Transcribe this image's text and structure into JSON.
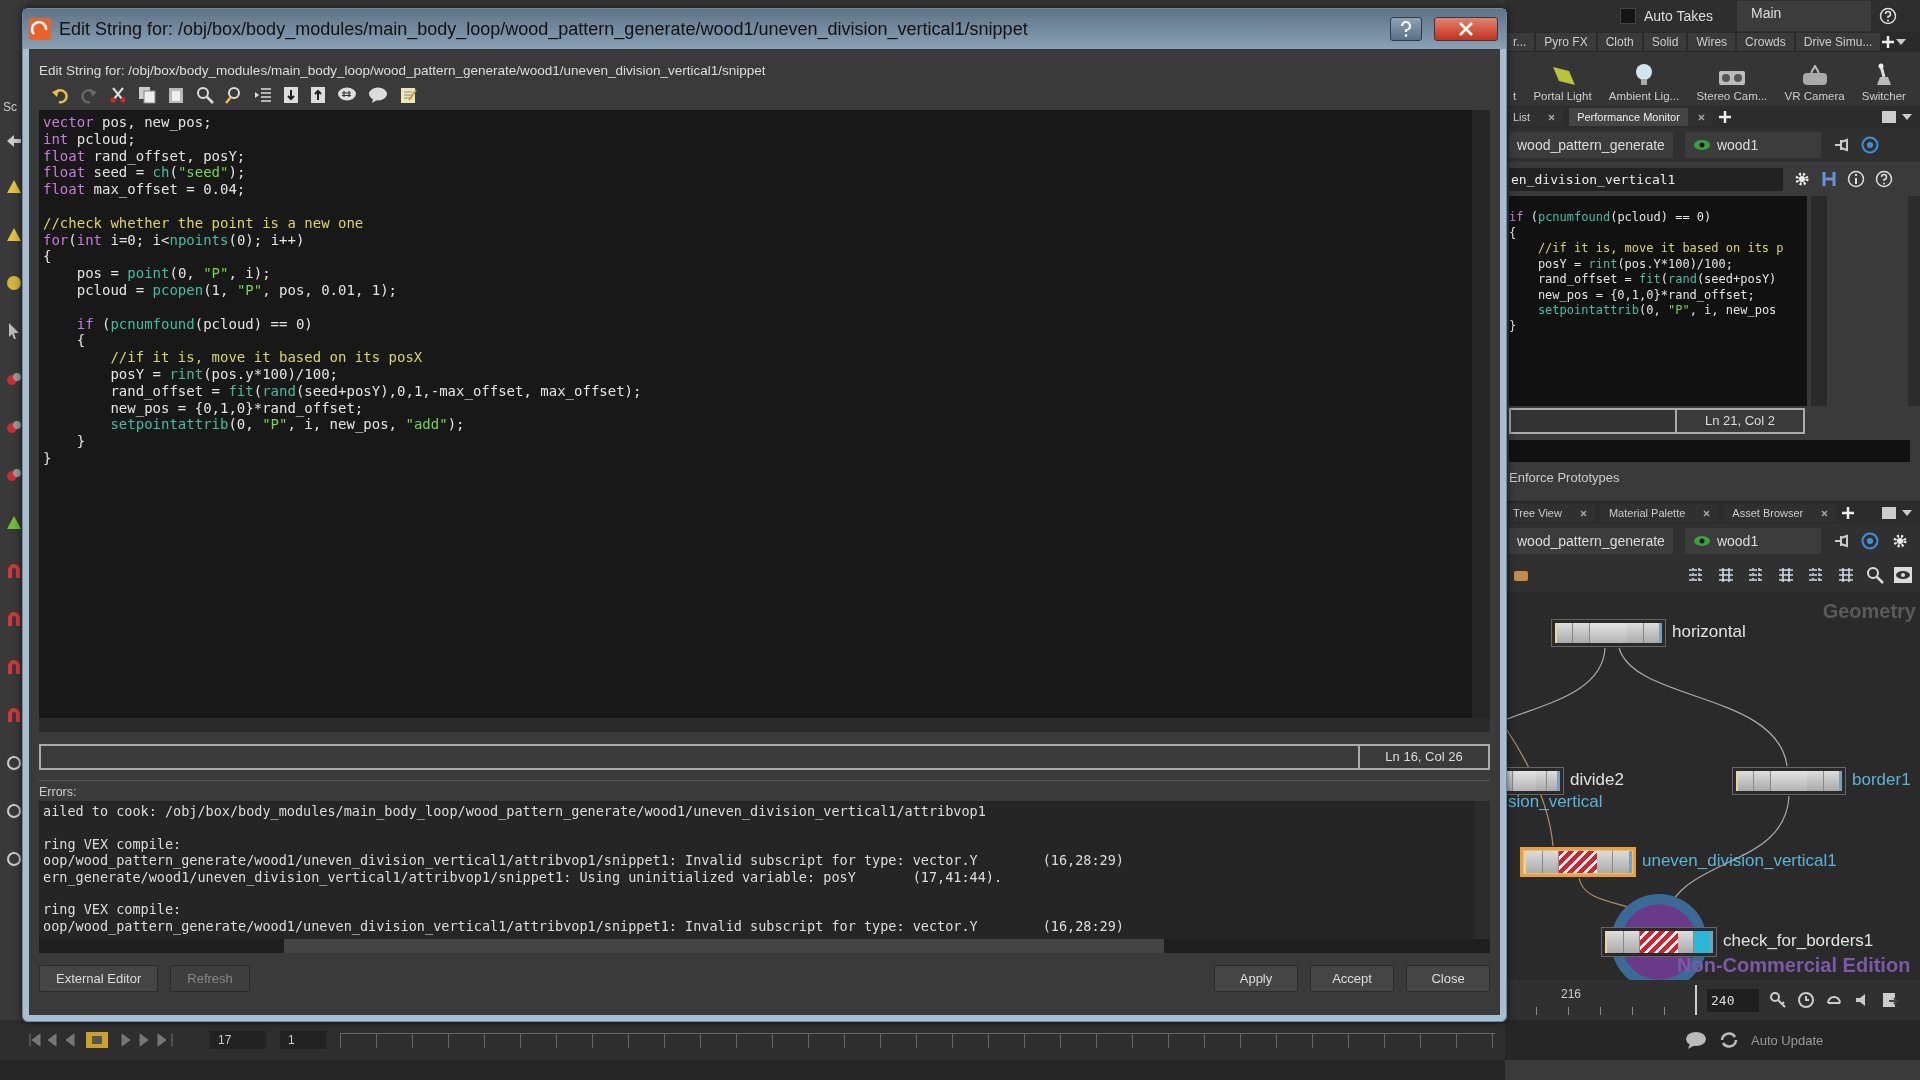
{
  "left_edge": {
    "label": "Sc"
  },
  "dialog": {
    "title": "Edit String for: /obj/box/body_modules/main_body_loop/wood_pattern_generate/wood1/uneven_division_vertical1/snippet",
    "path_label": "Edit String for: /obj/box/body_modules/main_body_loop/wood_pattern_generate/wood1/uneven_division_vertical1/snippet",
    "code": [
      {
        "tokens": [
          {
            "text": "vector",
            "kind": "type"
          },
          {
            "text": " pos, new_pos;",
            "kind": "plain"
          }
        ]
      },
      {
        "tokens": [
          {
            "text": "int",
            "kind": "type"
          },
          {
            "text": " pcloud;",
            "kind": "plain"
          }
        ]
      },
      {
        "tokens": [
          {
            "text": "float",
            "kind": "type"
          },
          {
            "text": " rand_offset, posY;",
            "kind": "plain"
          }
        ]
      },
      {
        "tokens": [
          {
            "text": "float",
            "kind": "type"
          },
          {
            "text": " seed = ",
            "kind": "plain"
          },
          {
            "text": "ch",
            "kind": "fn"
          },
          {
            "text": "(",
            "kind": "plain"
          },
          {
            "text": "\"seed\"",
            "kind": "str"
          },
          {
            "text": ");",
            "kind": "plain"
          }
        ]
      },
      {
        "tokens": [
          {
            "text": "float",
            "kind": "type"
          },
          {
            "text": " max_offset = 0.04;",
            "kind": "plain"
          }
        ]
      },
      {
        "gap_before": true,
        "tokens": [
          {
            "text": "//check whether the point is a new one",
            "kind": "comment"
          }
        ]
      },
      {
        "tokens": [
          {
            "text": "for",
            "kind": "type"
          },
          {
            "text": "(",
            "kind": "plain"
          },
          {
            "text": "int",
            "kind": "type"
          },
          {
            "text": " i=0; i<",
            "kind": "plain"
          },
          {
            "text": "npoints",
            "kind": "fn"
          },
          {
            "text": "(0); i++)",
            "kind": "plain"
          }
        ]
      },
      {
        "tokens": [
          {
            "text": "{",
            "kind": "plain"
          }
        ]
      },
      {
        "tokens": [
          {
            "text": "    pos = ",
            "kind": "plain"
          },
          {
            "text": "point",
            "kind": "fn"
          },
          {
            "text": "(0, ",
            "kind": "plain"
          },
          {
            "text": "\"P\"",
            "kind": "str"
          },
          {
            "text": ", i);",
            "kind": "plain"
          }
        ]
      },
      {
        "tokens": [
          {
            "text": "    pcloud = ",
            "kind": "plain"
          },
          {
            "text": "pcopen",
            "kind": "fn"
          },
          {
            "text": "(1, ",
            "kind": "plain"
          },
          {
            "text": "\"P\"",
            "kind": "str"
          },
          {
            "text": ", pos, 0.01, 1);",
            "kind": "plain"
          }
        ]
      },
      {
        "gap_before": true,
        "tokens": [
          {
            "text": "    if",
            "kind": "type"
          },
          {
            "text": " (",
            "kind": "plain"
          },
          {
            "text": "pcnumfound",
            "kind": "fn"
          },
          {
            "text": "(pcloud) == 0)",
            "kind": "plain"
          }
        ]
      },
      {
        "tokens": [
          {
            "text": "    {",
            "kind": "plain"
          }
        ]
      },
      {
        "tokens": [
          {
            "text": "        //if it is, move it based on its posX",
            "kind": "comment"
          }
        ]
      },
      {
        "tokens": [
          {
            "text": "        posY = ",
            "kind": "plain"
          },
          {
            "text": "rint",
            "kind": "fn"
          },
          {
            "text": "(pos.y*100)/100;",
            "kind": "plain"
          }
        ]
      },
      {
        "tokens": [
          {
            "text": "        rand_offset = ",
            "kind": "plain"
          },
          {
            "text": "fit",
            "kind": "fn"
          },
          {
            "text": "(",
            "kind": "plain"
          },
          {
            "text": "rand",
            "kind": "fn"
          },
          {
            "text": "(seed+posY),0,1,-max_offset, max_offset);",
            "kind": "plain"
          }
        ]
      },
      {
        "tokens": [
          {
            "text": "        new_pos = {0,1,0}*rand_offset;",
            "kind": "plain"
          }
        ]
      },
      {
        "tokens": [
          {
            "text": "        setpointattrib",
            "kind": "fn"
          },
          {
            "text": "(0, ",
            "kind": "plain"
          },
          {
            "text": "\"P\"",
            "kind": "str"
          },
          {
            "text": ", i, new_pos, ",
            "kind": "plain"
          },
          {
            "text": "\"add\"",
            "kind": "str"
          },
          {
            "text": ");",
            "kind": "plain"
          }
        ]
      },
      {
        "tokens": [
          {
            "text": "    }",
            "kind": "plain"
          }
        ]
      },
      {
        "tokens": [
          {
            "text": "}",
            "kind": "plain"
          }
        ]
      }
    ],
    "cursor_status": "Ln 16, Col 26",
    "errors_label": "Errors:",
    "errors": [
      {
        "lines": [
          "ailed to cook: /obj/box/body_modules/main_body_loop/wood_pattern_generate/wood1/uneven_division_vertical1/attribvop1"
        ]
      },
      {
        "lines": [
          "ring VEX compile:",
          "oop/wood_pattern_generate/wood1/uneven_division_vertical1/attribvop1/snippet1: Invalid subscript for type: vector.Y        (16,28:29)",
          "ern_generate/wood1/uneven_division_vertical1/attribvop1/snippet1: Using uninitialized variable: posY       (17,41:44)."
        ]
      },
      {
        "lines": [
          "ring VEX compile:",
          "oop/wood_pattern_generate/wood1/uneven_division_vertical1/attribvop1/snippet1: Invalid subscript for type: vector.Y        (16,28:29)"
        ]
      }
    ],
    "buttons_left": [
      {
        "label": "External Editor",
        "disabled": false
      },
      {
        "label": "Refresh",
        "disabled": true
      }
    ],
    "buttons_right": [
      {
        "label": "Apply"
      },
      {
        "label": "Accept"
      },
      {
        "label": "Close"
      }
    ]
  },
  "top_bar": {
    "auto_takes": {
      "label": "Auto Takes",
      "checked": false
    },
    "take": "Main"
  },
  "shelf_tabs": [
    "r...",
    "Pyro FX",
    "Cloth",
    "Solid",
    "Wires",
    "Crowds",
    "Drive Simu..."
  ],
  "shelf_tools": [
    {
      "label": "t",
      "kind": "none"
    },
    {
      "label": "Portal Light",
      "kind": "portal"
    },
    {
      "label": "Ambient Lig...",
      "kind": "bulb"
    },
    {
      "label": "Stereo Cam...",
      "kind": "camera"
    },
    {
      "label": "VR Camera",
      "kind": "vr"
    },
    {
      "label": "Switcher",
      "kind": "switch"
    }
  ],
  "pane_tabs_top": [
    {
      "label": "List",
      "selected": false
    },
    {
      "label": "Performance Monitor",
      "selected": true
    }
  ],
  "path_top": {
    "network": "wood_pattern_generate",
    "node": "wood1"
  },
  "param_node_name": "en_division_vertical1",
  "mini_code": [
    {
      "tokens": [
        {
          "text": "if",
          "kind": "type"
        },
        {
          "text": " (",
          "kind": "plain"
        },
        {
          "text": "pcnumfound",
          "kind": "fn"
        },
        {
          "text": "(pcloud) == 0)",
          "kind": "plain"
        }
      ]
    },
    {
      "tokens": [
        {
          "text": "{",
          "kind": "plain"
        }
      ]
    },
    {
      "tokens": [
        {
          "text": "    //if it is, move it based on its p",
          "kind": "comment"
        }
      ]
    },
    {
      "tokens": [
        {
          "text": "    posY = ",
          "kind": "plain"
        },
        {
          "text": "rint",
          "kind": "fn"
        },
        {
          "text": "(pos.Y*100)/100;",
          "kind": "plain"
        }
      ]
    },
    {
      "tokens": [
        {
          "text": "    rand_offset = ",
          "kind": "plain"
        },
        {
          "text": "fit",
          "kind": "fn"
        },
        {
          "text": "(",
          "kind": "plain"
        },
        {
          "text": "rand",
          "kind": "fn"
        },
        {
          "text": "(seed+posY)",
          "kind": "plain"
        }
      ]
    },
    {
      "tokens": [
        {
          "text": "    new_pos = {0,1,0}*rand_offset;",
          "kind": "plain"
        }
      ]
    },
    {
      "tokens": [
        {
          "text": "    setpointattrib",
          "kind": "fn"
        },
        {
          "text": "(0, ",
          "kind": "plain"
        },
        {
          "text": "\"P\"",
          "kind": "str"
        },
        {
          "text": ", i, new_pos",
          "kind": "plain"
        }
      ]
    },
    {
      "tokens": [
        {
          "text": "}",
          "kind": "plain"
        }
      ]
    }
  ],
  "mini_status": "Ln 21, Col 2",
  "param_label": "Enforce Prototypes",
  "pane_tabs_bottom": [
    {
      "label": "Tree View",
      "selected": false
    },
    {
      "label": "Material Palette",
      "selected": false
    },
    {
      "label": "Asset Browser",
      "selected": false
    }
  ],
  "path_bottom": {
    "network": "wood_pattern_generate",
    "node": "wood1"
  },
  "network": {
    "context": "Geometry",
    "edition": "Non-Commercial Edition",
    "offscreen_label": "sion_vertical",
    "nodes": [
      {
        "name": "horizontal",
        "error": false,
        "selected": false,
        "display": false,
        "color": "#e2e2e2"
      },
      {
        "name": "divide2",
        "error": false,
        "selected": false,
        "display": false,
        "color": "#e2e2e2"
      },
      {
        "name": "border1",
        "error": false,
        "selected": false,
        "display": false,
        "color": "#5ab4d6"
      },
      {
        "name": "uneven_division_vertical1",
        "error": true,
        "selected": true,
        "display": false,
        "color": "#5ab4d6"
      },
      {
        "name": "check_for_borders1",
        "error": true,
        "selected": false,
        "display": true,
        "color": "#e2e2e2"
      }
    ]
  },
  "timeline": {
    "tick": "216",
    "end_frame": "240",
    "frame": "17",
    "start": "1"
  },
  "status": {
    "auto_update": "Auto Update"
  }
}
